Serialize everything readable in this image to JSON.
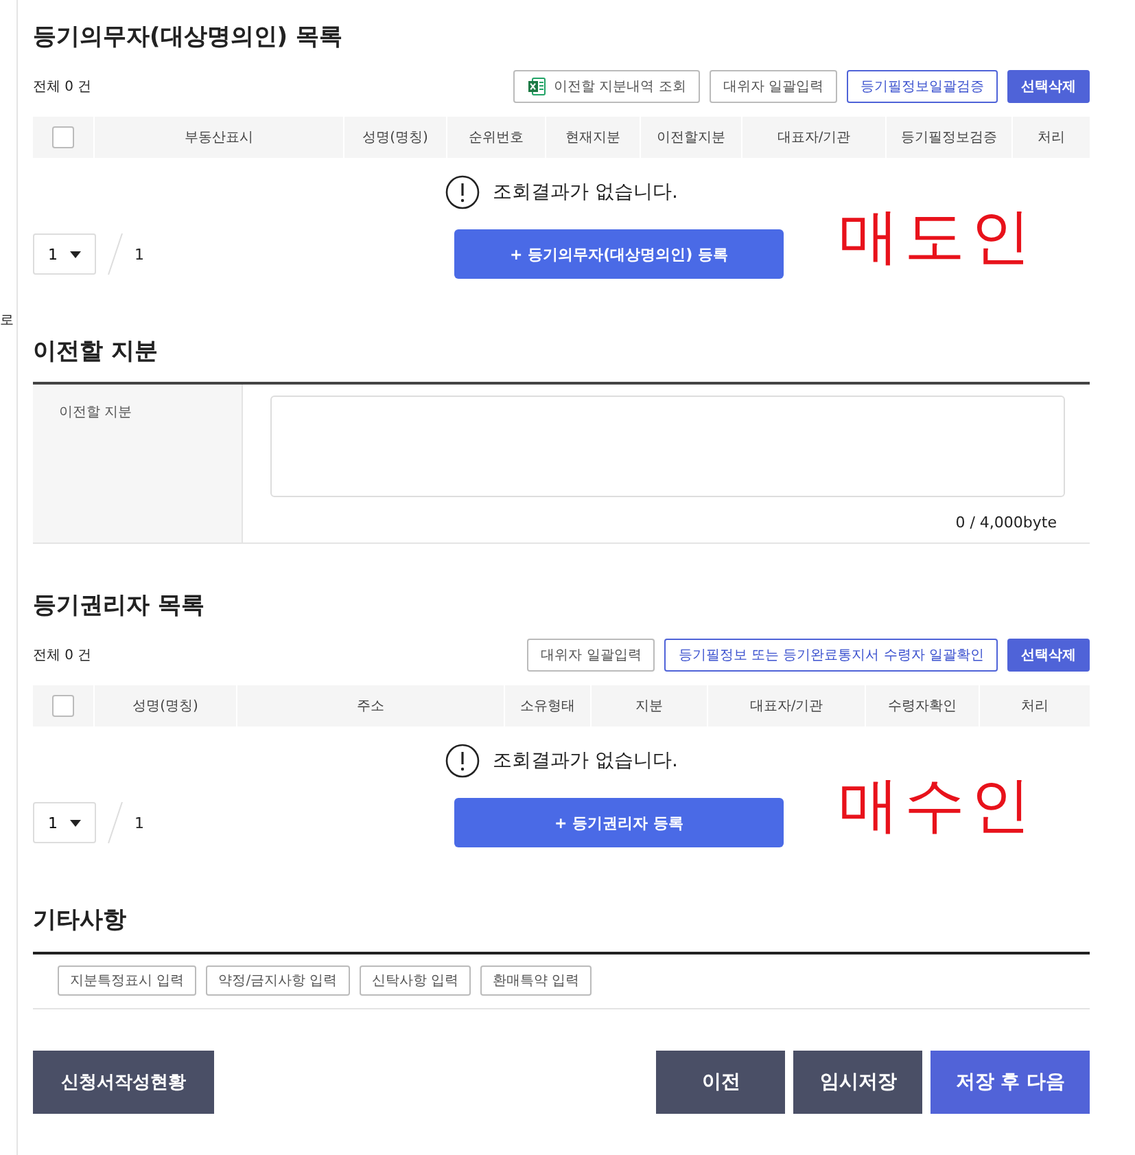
{
  "side_fragment": "로",
  "sections": [
    {
      "kind": "list",
      "title": "등기의무자(대상명의인) 목록",
      "count": "전체 0 건",
      "actions": [
        {
          "label": "이전할 지분내역 조회",
          "kind": "excel"
        },
        {
          "label": "대위자 일괄입력",
          "kind": "outline"
        },
        {
          "label": "등기필정보일괄검증",
          "kind": "primary-outline"
        },
        {
          "label": "선택삭제",
          "kind": "primary"
        }
      ],
      "columns": [
        "부동산표시",
        "성명(명칭)",
        "순위번호",
        "현재지분",
        "이전할지분",
        "대표자/기관",
        "등기필정보검증",
        "처리"
      ],
      "select_all_checked": false,
      "empty_message": "조회결과가 없습니다.",
      "pagination": {
        "page": "1",
        "total": "1"
      },
      "register_button": "+ 등기의무자(대상명의인) 등록",
      "annotation": "매도인"
    },
    {
      "kind": "form",
      "title": "이전할 지분",
      "field_label": "이전할 지분",
      "counter": "0 / 4,000byte"
    },
    {
      "kind": "list",
      "title": "등기권리자 목록",
      "count": "전체 0 건",
      "actions": [
        {
          "label": "대위자 일괄입력",
          "kind": "outline"
        },
        {
          "label": "등기필정보 또는 등기완료통지서 수령자 일괄확인",
          "kind": "primary-outline"
        },
        {
          "label": "선택삭제",
          "kind": "primary"
        }
      ],
      "columns": [
        "성명(명칭)",
        "주소",
        "소유형태",
        "지분",
        "대표자/기관",
        "수령자확인",
        "처리"
      ],
      "select_all_checked": false,
      "empty_message": "조회결과가 없습니다.",
      "pagination": {
        "page": "1",
        "total": "1"
      },
      "register_button": "+ 등기권리자 등록",
      "annotation": "매수인"
    },
    {
      "kind": "etc",
      "title": "기타사항",
      "buttons": [
        "지분특정표시 입력",
        "약정/금지사항 입력",
        "신탁사항 입력",
        "환매특약 입력"
      ]
    }
  ],
  "footer": {
    "status_button": "신청서작성현황",
    "buttons": [
      {
        "label": "이전",
        "kind": "dark"
      },
      {
        "label": "임시저장",
        "kind": "dark"
      },
      {
        "label": "저장 후 다음",
        "kind": "primary"
      }
    ]
  }
}
